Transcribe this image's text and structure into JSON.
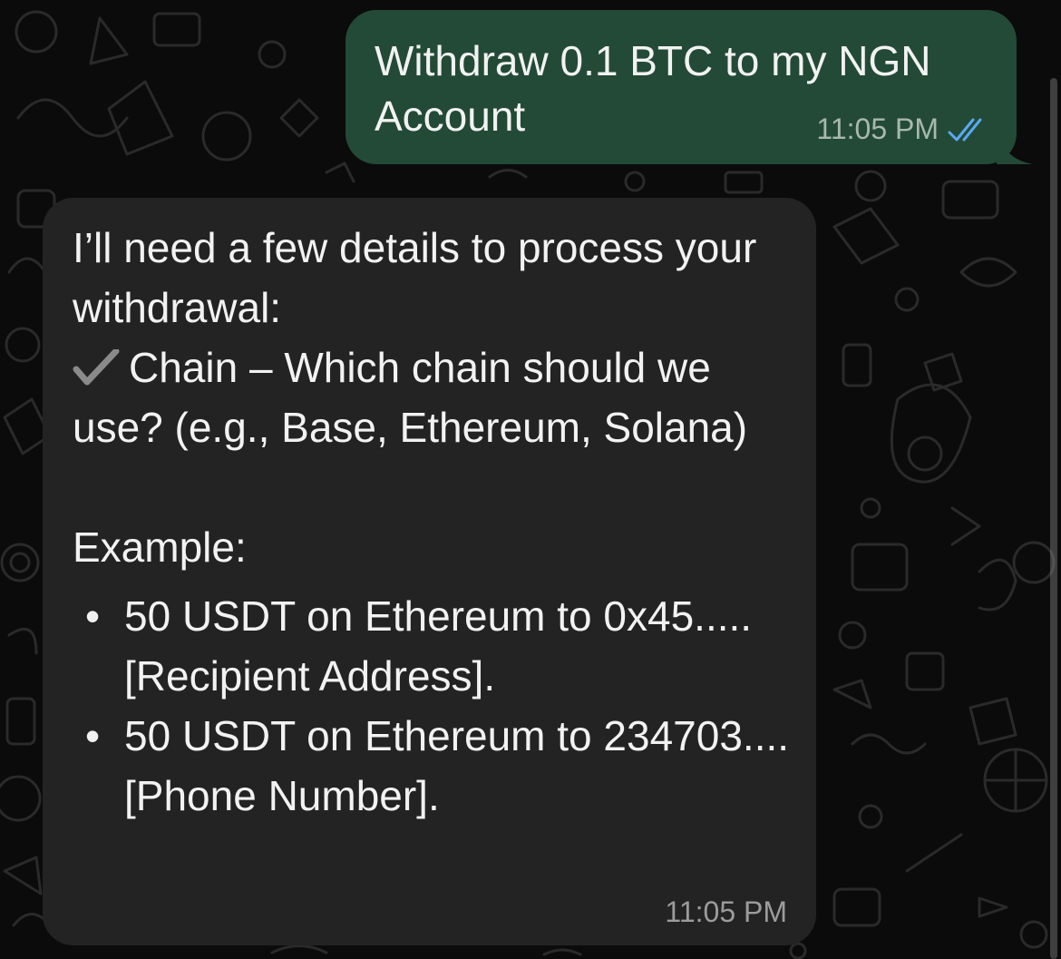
{
  "messages": {
    "outgoing": {
      "text": "Withdraw 0.1 BTC to my NGN Account",
      "time": "11:05 PM",
      "status_icon": "double-check-read-icon",
      "bubble_color": "#234a36",
      "tick_color": "#5aa9f2"
    },
    "incoming": {
      "intro": "I’ll need a few details to process your withdrawal:",
      "check_icon": "heavy-check-mark-icon",
      "chain_prompt": "Chain – Which chain should we use? (e.g., Base, Ethereum, Solana)",
      "example_heading": "Example:",
      "bullet_symbol": "•",
      "examples": [
        "50 USDT on Ethereum to 0x45.....[Recipient Address].",
        "50 USDT on Ethereum to 234703....[Phone Number]."
      ],
      "time": "11:05 PM",
      "bubble_color": "#222322"
    }
  },
  "wallpaper": {
    "pattern": "doodle-pattern",
    "background": "#0b0b0b",
    "stroke": "#2a2a2a"
  }
}
